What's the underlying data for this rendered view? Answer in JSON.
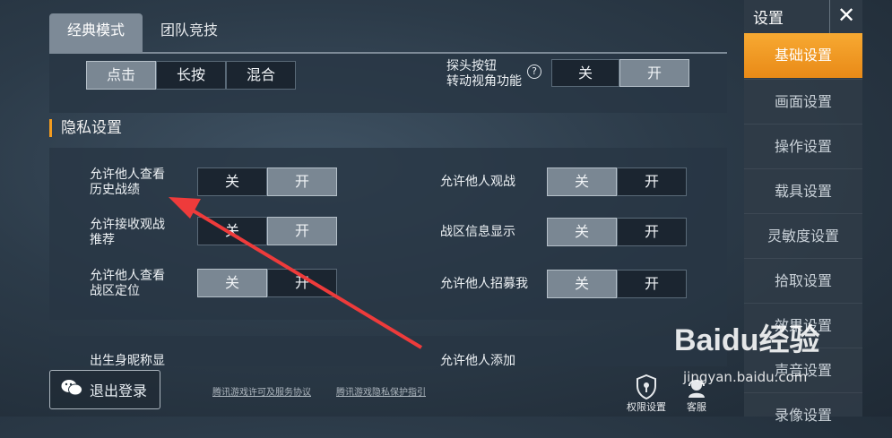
{
  "tabs": [
    "经典模式",
    "团队竞技"
  ],
  "top_panel": {
    "segment": [
      "点击",
      "长按",
      "混合"
    ],
    "peek_label_line1": "探头按钮",
    "peek_label_line2": "转动视角功能",
    "peek_off": "关",
    "peek_on": "开"
  },
  "privacy": {
    "title": "隐私设置",
    "rows": [
      {
        "label1": "允许他人查看",
        "label2": "历史战绩",
        "off": "关",
        "on": "开"
      },
      {
        "label1": "允许接收观战",
        "label2": "推荐",
        "off": "关",
        "on": "开"
      },
      {
        "label1": "允许他人查看",
        "label2": "战区定位",
        "off": "关",
        "on": "开"
      }
    ],
    "rows_right": [
      {
        "label": "允许他人观战",
        "off": "关",
        "on": "开"
      },
      {
        "label": "战区信息显示",
        "off": "关",
        "on": "开"
      },
      {
        "label": "允许他人招募我",
        "off": "关",
        "on": "开"
      }
    ],
    "partial_left": "出生身昵称显",
    "partial_right": "允许他人添加"
  },
  "sidebar": {
    "title": "设置",
    "close": "✕",
    "items": [
      "基础设置",
      "画面设置",
      "操作设置",
      "载具设置",
      "灵敏度设置",
      "拾取设置",
      "效果设置",
      "声音设置",
      "录像设置"
    ]
  },
  "bottom": {
    "logout": "退出登录",
    "link1": "腾讯游戏许可及服务协议",
    "link2": "腾讯游戏隐私保护指引",
    "perm": "权限设置",
    "service": "客服"
  },
  "watermark": {
    "brand": "Baidu经验",
    "url": "jingyan.baidu.com"
  },
  "colors": {
    "accent": "#f39c1f",
    "annotation_arrow": "#ee3b3b"
  }
}
